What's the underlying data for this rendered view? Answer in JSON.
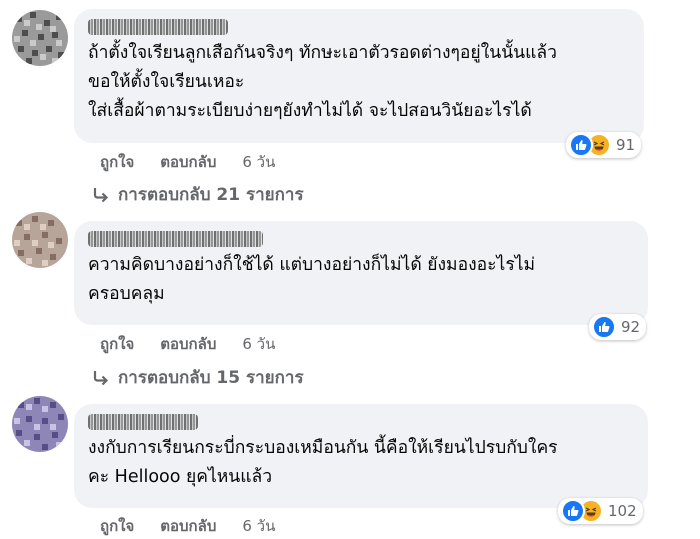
{
  "comments": [
    {
      "lines": [
        "ถ้าตั้งใจเรียนลูกเสือกันจริงๆ ทักษะเอาตัวรอดต่างๆอยู่ในนั้นแล้ว",
        "ขอให้ตั้งใจเรียนเหอะ",
        "ใส่เสื้อผ้าตามระเบียบง่ายๆยังทำไม่ได้ จะไปสอนวินัยอะไรได้"
      ],
      "reactions": [
        "like-icon",
        "haha-icon"
      ],
      "reaction_count": "91",
      "like_label": "ถูกใจ",
      "reply_label": "ตอบกลับ",
      "time": "6 วัน",
      "replies_label": "การตอบกลับ 21 รายการ"
    },
    {
      "lines": [
        "ความคิดบางอย่างก็ใช้ได้ แต่บางอย่างก็ไม่ได้ ยังมองอะไรไม่",
        "ครอบคลุม"
      ],
      "reactions": [
        "like-icon"
      ],
      "reaction_count": "92",
      "like_label": "ถูกใจ",
      "reply_label": "ตอบกลับ",
      "time": "6 วัน",
      "replies_label": "การตอบกลับ 15 รายการ"
    },
    {
      "lines": [
        "งงกับการเรียนกระบี่กระบองเหมือนกัน นี้คือให้เรียนไปรบกับใคร",
        "คะ Hellooo ยุคไหนแล้ว"
      ],
      "reactions": [
        "like-icon",
        "haha-icon"
      ],
      "reaction_count": "102",
      "like_label": "ถูกใจ",
      "reply_label": "ตอบกลับ",
      "time": "6 วัน"
    }
  ],
  "colors": {
    "bubble": "#f0f2f5",
    "secondary_text": "#65676b",
    "like_blue": "#1877f2",
    "haha_yellow": "#f7b125"
  }
}
